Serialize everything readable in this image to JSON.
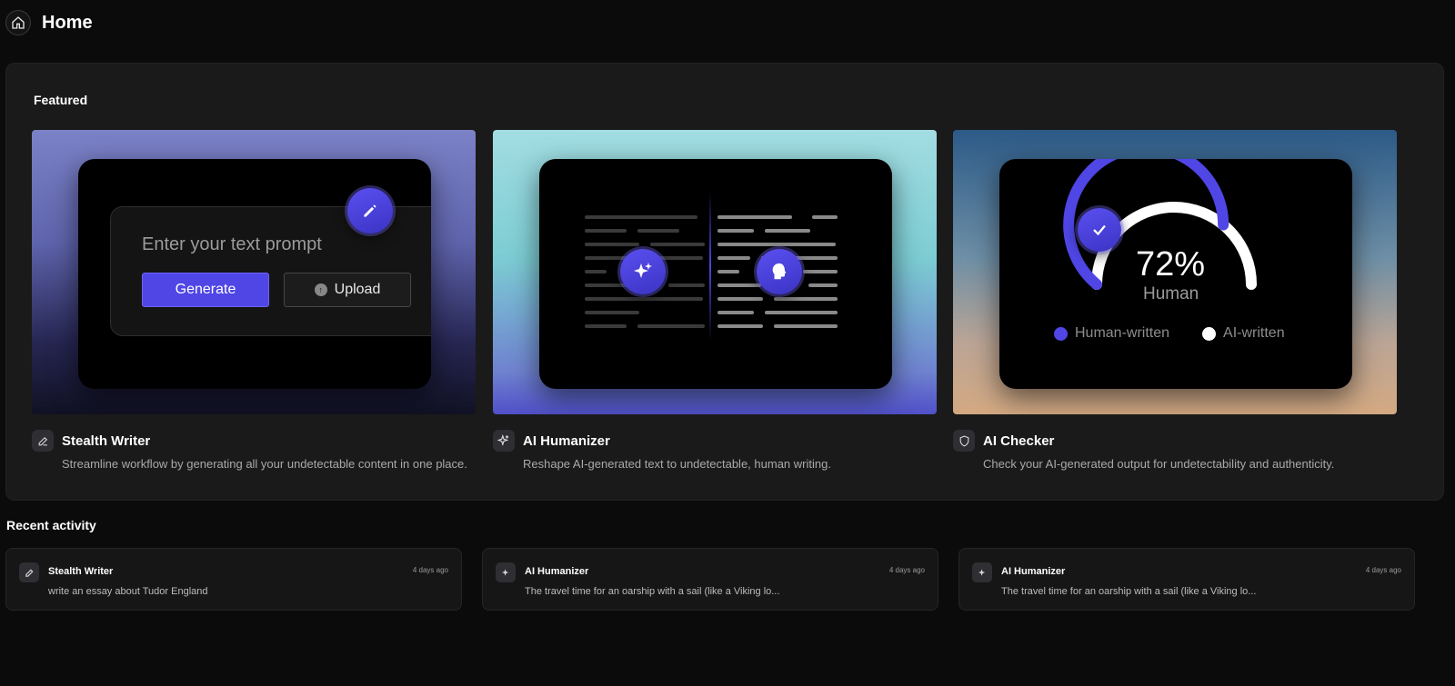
{
  "header": {
    "title": "Home",
    "home_icon": "home-icon"
  },
  "featured": {
    "title": "Featured",
    "cards": [
      {
        "name": "Stealth Writer",
        "description": "Streamline workflow by generating all your undetectable content in one place.",
        "icon": "pencil-icon",
        "illustration": {
          "prompt_placeholder": "Enter your text prompt",
          "generate_label": "Generate",
          "upload_label": "Upload"
        }
      },
      {
        "name": "AI Humanizer",
        "description": "Reshape AI-generated text to undetectable, human writing.",
        "icon": "sparkles-icon"
      },
      {
        "name": "AI Checker",
        "description": "Check your AI-generated output for undetectability and authenticity.",
        "icon": "shield-icon",
        "illustration": {
          "score": "72%",
          "score_label": "Human",
          "score_fraction": 0.72,
          "legend_human": "Human-written",
          "legend_ai": "AI-written"
        }
      }
    ]
  },
  "recent": {
    "title": "Recent activity",
    "items": [
      {
        "tool": "Stealth Writer",
        "time": "4 days ago",
        "text": "write an essay about Tudor England",
        "icon": "pencil-icon"
      },
      {
        "tool": "AI Humanizer",
        "time": "4 days ago",
        "text": "The travel time for an oarship with a sail (like a Viking lo...",
        "icon": "sparkles-icon"
      },
      {
        "tool": "AI Humanizer",
        "time": "4 days ago",
        "text": "The travel time for an oarship with a sail (like a Viking lo...",
        "icon": "sparkles-icon"
      }
    ]
  },
  "colors": {
    "accent": "#4f46e5",
    "background": "#0b0b0b",
    "panel": "#1a1a1a"
  }
}
